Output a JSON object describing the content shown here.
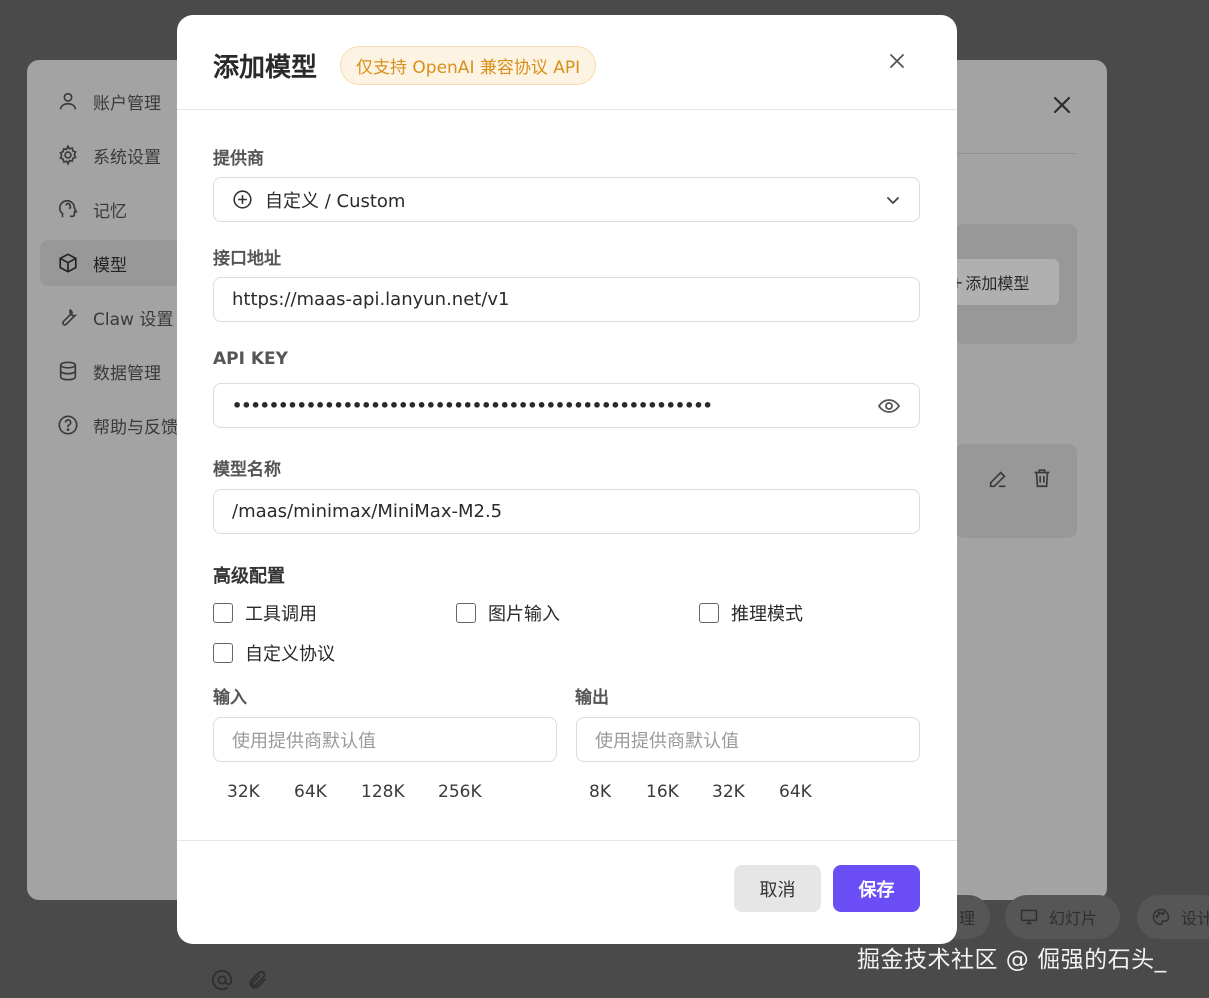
{
  "background": {
    "nav_items": [
      {
        "label": "账户管理",
        "icon": "user-icon"
      },
      {
        "label": "系统设置",
        "icon": "gear-icon"
      },
      {
        "label": "记忆",
        "icon": "head-brain-icon"
      },
      {
        "label": "模型",
        "icon": "cube-icon",
        "active": true
      },
      {
        "label": "Claw 设置",
        "icon": "wrench-icon"
      },
      {
        "label": "数据管理",
        "icon": "database-icon"
      },
      {
        "label": "帮助与反馈",
        "icon": "help-circle-icon"
      }
    ],
    "add_model_label": "添加模型",
    "bottom_pills": [
      {
        "label": "理"
      },
      {
        "label": "幻灯片",
        "icon": "monitor-icon"
      },
      {
        "label": "设计",
        "icon": "palette-icon"
      }
    ]
  },
  "watermark": "掘金技术社区 @ 倔强的石头_",
  "modal": {
    "title": "添加模型",
    "badge": "仅支持 OpenAI 兼容协议 API",
    "provider": {
      "label": "提供商",
      "value": "自定义 / Custom"
    },
    "endpoint": {
      "label": "接口地址",
      "value": "https://maas-api.lanyun.net/v1"
    },
    "api_key": {
      "label": "API KEY",
      "value": "••••••••••••••••••••••••••••••••••••••••••••••••••••"
    },
    "model_name": {
      "label": "模型名称",
      "value": "/maas/minimax/MiniMax-M2.5"
    },
    "advanced": {
      "label": "高级配置",
      "options": [
        {
          "label": "工具调用",
          "checked": false
        },
        {
          "label": "图片输入",
          "checked": false
        },
        {
          "label": "推理模式",
          "checked": false
        },
        {
          "label": "自定义协议",
          "checked": false
        }
      ]
    },
    "input_tokens": {
      "label": "输入",
      "placeholder": "使用提供商默认值",
      "presets": [
        "32K",
        "64K",
        "128K",
        "256K"
      ]
    },
    "output_tokens": {
      "label": "输出",
      "placeholder": "使用提供商默认值",
      "presets": [
        "8K",
        "16K",
        "32K",
        "64K"
      ]
    },
    "cancel_label": "取消",
    "save_label": "保存"
  },
  "colors": {
    "accent": "#6b4ef6",
    "badge_text": "#d8901b",
    "badge_bg": "#fdf3e3"
  }
}
